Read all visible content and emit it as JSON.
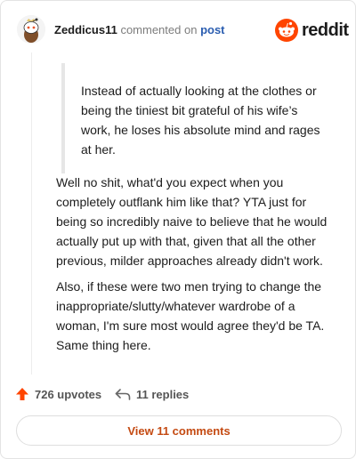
{
  "comment": {
    "username": "Zeddicus11",
    "action_text": "commented on",
    "post_link": "post",
    "quote": "Instead of actually looking at the clothes or being the tiniest bit grateful of his wife’s work, he loses his absolute mind and rages at her.",
    "paragraphs": [
      "Well no shit, what'd you expect when you completely outflank him like that? YTA just for being so incredibly naive to believe that he would actually put up with that, given that all the other previous, milder approaches already didn't work.",
      "Also, if these were two men trying to change the inappropriate/slutty/whatever wardrobe of a woman, I'm sure most would agree they'd be TA. Same thing here."
    ]
  },
  "brand": {
    "name": "reddit",
    "icon": "reddit-logo-icon",
    "color": "#ff4500"
  },
  "actions": {
    "upvotes": "726 upvotes",
    "replies": "11 replies",
    "view_button": "View 11 comments"
  },
  "colors": {
    "accent": "#ff4500",
    "link": "#2a5db0",
    "view_button_text": "#c44a12"
  }
}
